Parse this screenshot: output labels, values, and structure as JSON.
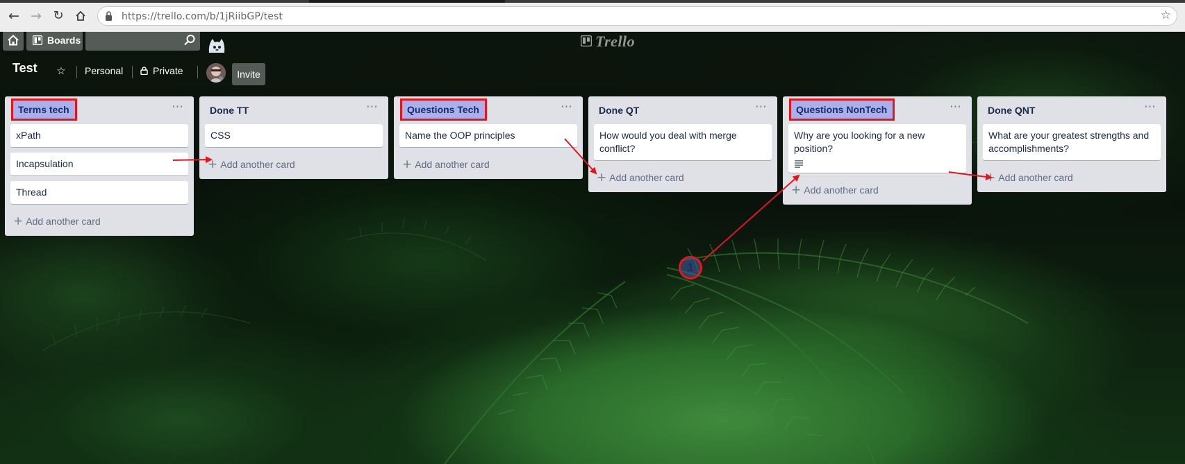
{
  "browser": {
    "url": "https://trello.com/b/1jRiibGP/test",
    "icons": [
      "back-icon",
      "forward-icon",
      "reload-icon",
      "home-icon",
      "lock-icon",
      "bookmark-star-icon"
    ]
  },
  "header": {
    "boards_label": "Boards",
    "search_placeholder": "",
    "logo_text": "Trello"
  },
  "board": {
    "title": "Test",
    "personal_label": "Personal",
    "private_label": "Private",
    "invite_label": "Invite"
  },
  "lists": [
    {
      "title": "Terms tech",
      "highlighted": true,
      "cards": [
        {
          "text": "xPath"
        },
        {
          "text": "Incapsulation"
        },
        {
          "text": "Thread"
        }
      ],
      "add_label": "Add another card"
    },
    {
      "title": "Done TT",
      "highlighted": false,
      "cards": [
        {
          "text": "CSS"
        }
      ],
      "add_label": "Add another card"
    },
    {
      "title": "Questions Tech",
      "highlighted": true,
      "cards": [
        {
          "text": "Name the OOP principles"
        }
      ],
      "add_label": "Add another card"
    },
    {
      "title": "Done QT",
      "highlighted": false,
      "cards": [
        {
          "text": "How would you deal with merge conflict?"
        }
      ],
      "add_label": "Add another card"
    },
    {
      "title": "Questions NonTech",
      "highlighted": true,
      "cards": [
        {
          "text": "Why are you looking for a new position?",
          "has_description": true
        }
      ],
      "add_label": "Add another card"
    },
    {
      "title": "Done QNT",
      "highlighted": false,
      "cards": [
        {
          "text": "What are your greatest strengths and accomplishments?"
        }
      ],
      "add_label": "Add another card"
    }
  ],
  "annotation": {
    "marker_label": "1",
    "color": "#e8141b"
  },
  "colors": {
    "list_bg": "#dfe1e6",
    "highlight_bg": "#aab1ea",
    "text_dark": "#172b4d"
  }
}
